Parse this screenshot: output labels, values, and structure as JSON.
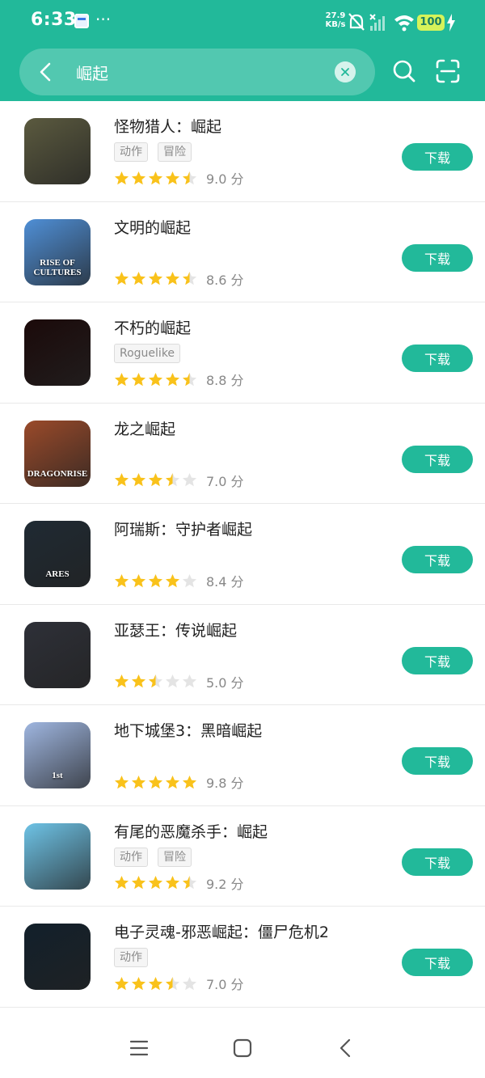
{
  "status_bar": {
    "time": "6:33",
    "more": "···",
    "net_speed_value": "27.9",
    "net_speed_unit": "KB/s",
    "battery": "100"
  },
  "search": {
    "query": "崛起"
  },
  "colors": {
    "accent": "#22b99a",
    "star": "#f9c21b",
    "star_empty": "#e4e4e4"
  },
  "apps": [
    {
      "name": "怪物猎人：崛起",
      "tags": [
        "动作",
        "冒险"
      ],
      "stars": 4.5,
      "score": "9.0 分",
      "button": "下载"
    },
    {
      "name": "文明的崛起",
      "tags": [],
      "stars": 4.5,
      "score": "8.6 分",
      "button": "下载"
    },
    {
      "name": "不朽的崛起",
      "tags": [
        "Roguelike"
      ],
      "stars": 4.5,
      "score": "8.8 分",
      "button": "下载"
    },
    {
      "name": "龙之崛起",
      "tags": [],
      "stars": 3.5,
      "score": "7.0 分",
      "button": "下载"
    },
    {
      "name": "阿瑞斯：守护者崛起",
      "tags": [],
      "stars": 4,
      "score": "8.4 分",
      "button": "下载"
    },
    {
      "name": "亚瑟王：传说崛起",
      "tags": [],
      "stars": 2.5,
      "score": "5.0 分",
      "button": "下载"
    },
    {
      "name": "地下城堡3：黑暗崛起",
      "tags": [],
      "stars": 5,
      "score": "9.8 分",
      "button": "下载"
    },
    {
      "name": "有尾的恶魔杀手：崛起",
      "tags": [
        "动作",
        "冒险"
      ],
      "stars": 4.5,
      "score": "9.2 分",
      "button": "下载"
    },
    {
      "name": "电子灵魂-邪恶崛起：僵尸危机2",
      "tags": [
        "动作"
      ],
      "stars": 3.5,
      "score": "7.0 分",
      "button": "下载"
    }
  ],
  "app_icons": [
    {
      "icon": "monster-hunter-icon",
      "text": "",
      "bg": "#5b5a3f"
    },
    {
      "icon": "rise-of-cultures-icon",
      "text": "RISE OF CULTURES",
      "bg": "#4f8fd6"
    },
    {
      "icon": "immortal-rising-icon",
      "text": "",
      "bg": "#1b0a0a"
    },
    {
      "icon": "dragon-rise-icon",
      "text": "DRAGONRISE",
      "bg": "#9a4a2a"
    },
    {
      "icon": "ares-icon",
      "text": "ARES",
      "bg": "#1f2a33"
    },
    {
      "icon": "king-arthur-icon",
      "text": "",
      "bg": "#2e3038"
    },
    {
      "icon": "dungeon-castle-icon",
      "text": "1st",
      "bg": "#9fb6e0"
    },
    {
      "icon": "tailed-demon-slayer-icon",
      "text": "",
      "bg": "#6ec3e6"
    },
    {
      "icon": "cyber-soul-icon",
      "text": "",
      "bg": "#12202b"
    }
  ],
  "nav": {
    "menu": "menu-icon",
    "home": "home-icon",
    "back": "back-icon"
  }
}
